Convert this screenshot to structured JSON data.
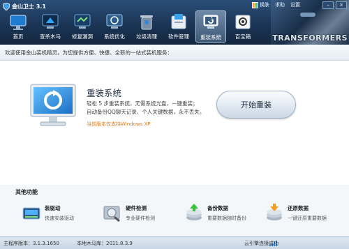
{
  "app": {
    "title": "金山卫士 3.1"
  },
  "topmenu": {
    "skin": "换肤",
    "help": "求助",
    "settings": "设置"
  },
  "tabs": [
    {
      "label": "首页",
      "icon": "home-icon"
    },
    {
      "label": "查杀木马",
      "icon": "scan-trojan-icon"
    },
    {
      "label": "修复漏洞",
      "icon": "fix-vulnerability-icon"
    },
    {
      "label": "系统优化",
      "icon": "system-optimize-icon"
    },
    {
      "label": "垃圾清理",
      "icon": "trash-clean-icon"
    },
    {
      "label": "软件管理",
      "icon": "software-manage-icon"
    },
    {
      "label": "重装系统",
      "icon": "reinstall-system-icon",
      "active": true
    },
    {
      "label": "百宝箱",
      "icon": "toolbox-icon"
    }
  ],
  "banner": {
    "brand": "TRANSFORMERS"
  },
  "welcome": "欢迎使用金山装机精灵，为您提供方便、快捷、全新的一站式装机服务：",
  "hero": {
    "title": "重装系统",
    "desc1": "轻松 5 步重装系统，无需系统光盘，一键重装；",
    "desc2": "自动备份QQ聊天记录、个人关键数据，永不丢失。",
    "note": "当前版本仅支持Windows XP",
    "button": "开始重装"
  },
  "other": {
    "title": "其他功能",
    "items": [
      {
        "title": "装驱动",
        "sub": "快速安装驱动",
        "icon": "driver-install-icon"
      },
      {
        "title": "硬件检测",
        "sub": "专业硬件检测",
        "icon": "hardware-check-icon"
      },
      {
        "title": "备份数据",
        "sub": "重要数据随时备份",
        "icon": "backup-data-icon"
      },
      {
        "title": "还原数据",
        "sub": "一键还原重要数据",
        "icon": "restore-data-icon"
      }
    ]
  },
  "status": {
    "version": "主程序版本：3.1.3.1650",
    "trojan_db": "本地木马库：2011.8.3.9",
    "connect": "云引擎连接成功"
  },
  "colors": {
    "header": "#1b3556",
    "note": "#e07b12",
    "accent": "#2e86de"
  }
}
